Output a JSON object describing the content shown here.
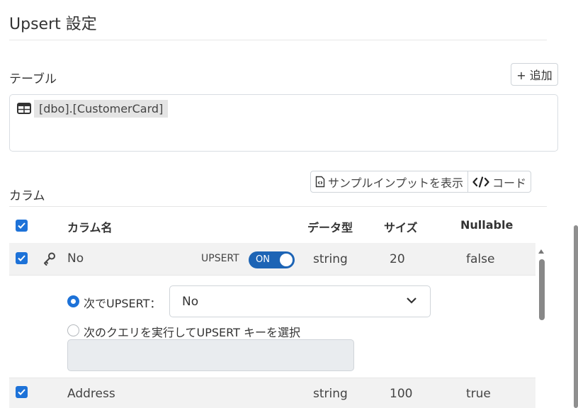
{
  "page": {
    "title": "Upsert 設定"
  },
  "tables_section": {
    "label": "テーブル",
    "add_button": "+ 追加",
    "items": [
      {
        "name": "[dbo].[CustomerCard]",
        "icon": "table-icon"
      }
    ]
  },
  "columns_section": {
    "label": "カラム",
    "sample_input_button": "サンプルインプットを表示",
    "code_button": "コード",
    "headers": {
      "name": "カラム名",
      "data_type": "データ型",
      "size": "サイズ",
      "nullable": "Nullable"
    },
    "rows": [
      {
        "checked": true,
        "key_icon": "key-icon",
        "name": "No",
        "upsert_label": "UPSERT",
        "toggle_label": "ON",
        "data_type": "string",
        "size": "20",
        "nullable": "false"
      },
      {
        "checked": true,
        "name": "Address",
        "data_type": "string",
        "size": "100",
        "nullable": "true"
      }
    ],
    "upsert_options": {
      "option_by_column_label": "次でUPSERT：",
      "option_by_column_selected": "No",
      "option_by_query_label": "次のクエリを実行してUPSERT キーを選択",
      "query_text": ""
    }
  },
  "colors": {
    "accent": "#1d72d8",
    "toggle": "#1d64b5",
    "row_highlight": "#f2f2f2"
  }
}
